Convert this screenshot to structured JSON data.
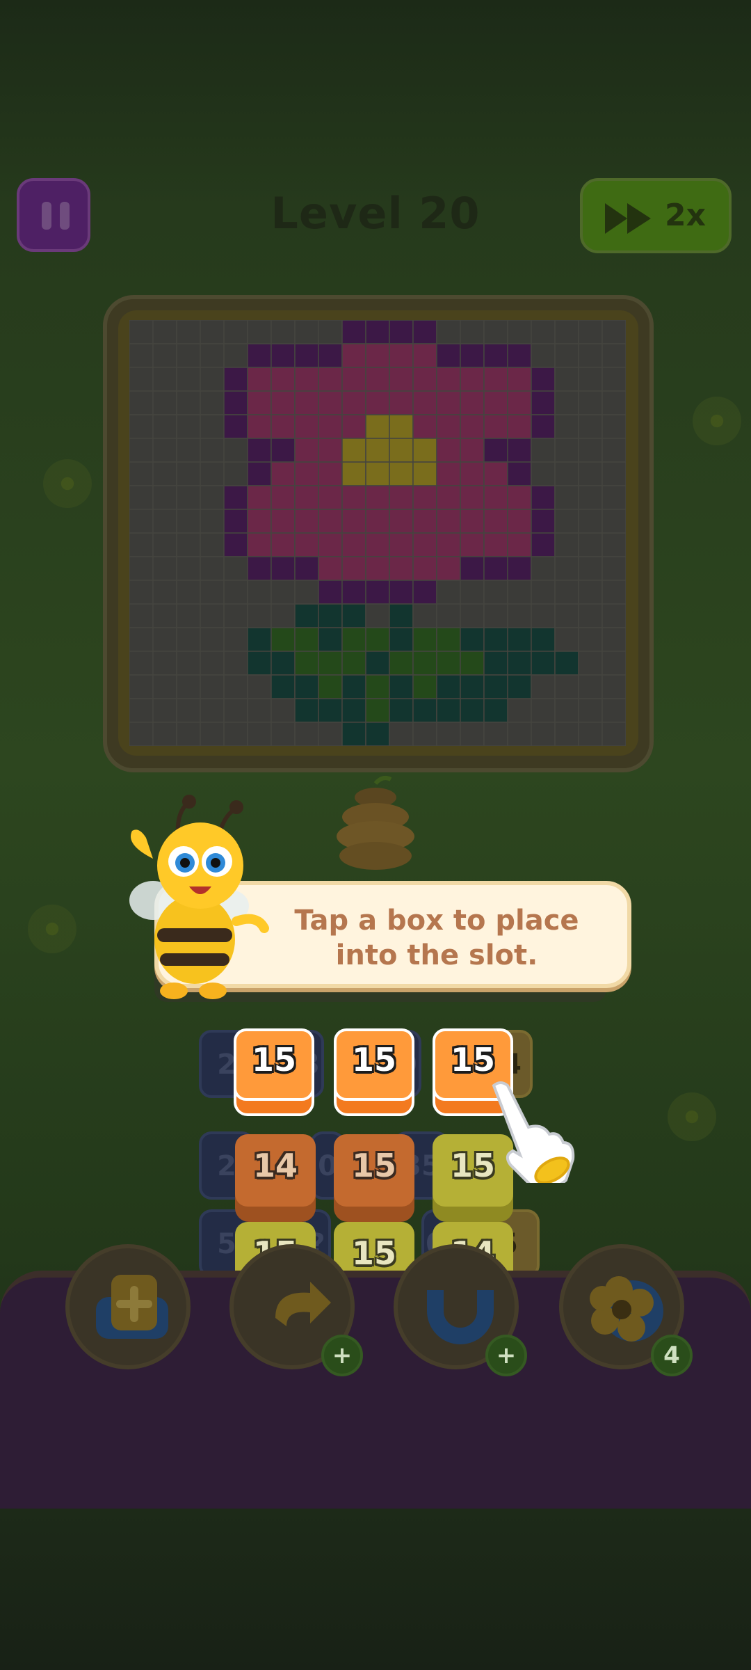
{
  "header": {
    "level_title": "Level 20",
    "speed_label": "2x"
  },
  "tutorial": {
    "message": "Tap a box to place into the slot."
  },
  "boxes": {
    "row1": [
      "15",
      "15",
      "15"
    ],
    "row2": [
      "14",
      "15",
      "15"
    ],
    "row3": [
      "15",
      "15",
      "14"
    ]
  },
  "background_tiles": {
    "row1": [
      "2",
      "3",
      "0",
      "4"
    ],
    "row2": [
      "2",
      "0",
      "35",
      ""
    ],
    "row3": [
      "5",
      "?",
      "0",
      "5"
    ]
  },
  "tools": {
    "shuffle_badge": "4"
  },
  "icons": [
    "pause-icon",
    "fast-forward-icon",
    "add-slot-icon",
    "undo-icon",
    "magnet-icon",
    "flower-shuffle-icon",
    "hand-pointer-icon",
    "bee-mascot",
    "honey-pot"
  ],
  "colors": {
    "highlight_box": "#ff9a3a",
    "tooltip_bg": "#fff4de",
    "tooltip_text": "#b5764e",
    "panel": "#2e1d35"
  }
}
